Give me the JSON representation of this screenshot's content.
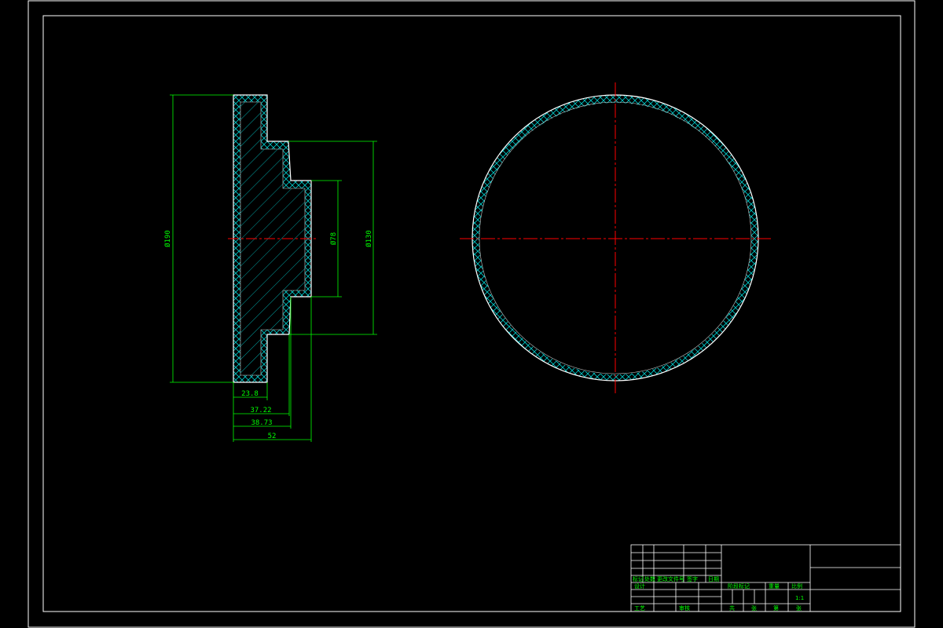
{
  "colors": {
    "background": "#000000",
    "frame": "#ffffff",
    "outline": "#ffffff",
    "hatch": "#00cccc",
    "dimension": "#00ff00",
    "centerline": "#ff0000"
  },
  "section_view": {
    "hatch_pattern": "diagonal",
    "dimensions": {
      "overall_diameter": "Ø190",
      "inner_diameter": "Ø78",
      "middle_diameter": "Ø130",
      "len_1": "23.8",
      "len_2": "37.22",
      "len_3": "38.73",
      "len_total": "52"
    }
  },
  "circle_view": {
    "hatch_pattern": "cross-hatch ring"
  },
  "title_block": {
    "row_labels": [
      "标记",
      "处数",
      "更改文件号",
      "签字",
      "日期"
    ],
    "designer_label": "设计",
    "approve_label": "审核",
    "stage_labels": [
      "阶段标记",
      "重量",
      "比例"
    ],
    "scale": "1:1",
    "sheet_labels": [
      "共",
      "张",
      "第",
      "张"
    ],
    "process_label": "工艺"
  }
}
